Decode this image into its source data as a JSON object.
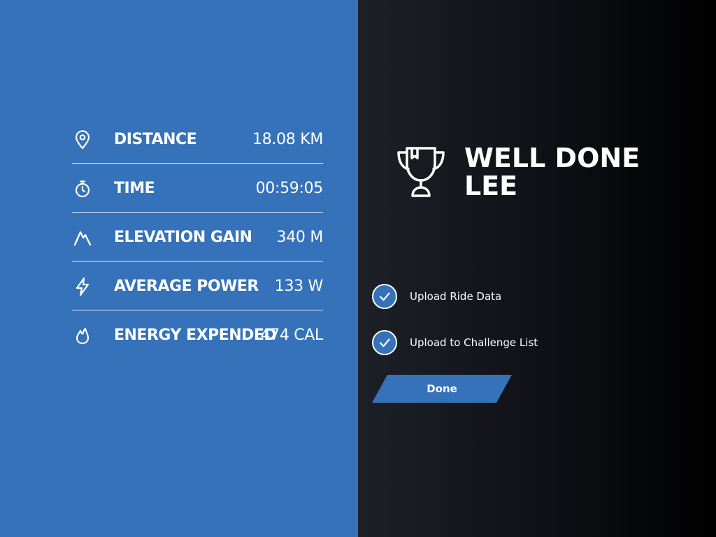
{
  "stats": [
    {
      "icon": "location-pin-icon",
      "label": "DISTANCE",
      "value": "18.08 KM"
    },
    {
      "icon": "stopwatch-icon",
      "label": "TIME",
      "value": "00:59:05"
    },
    {
      "icon": "mountain-icon",
      "label": "ELEVATION GAIN",
      "value": "340 M"
    },
    {
      "icon": "lightning-bolt-icon",
      "label": "AVERAGE POWER",
      "value": "133 W"
    },
    {
      "icon": "flame-icon",
      "label": "ENERGY EXPENDED",
      "value": "474 CAL"
    }
  ],
  "headline": {
    "line1": "WELL DONE",
    "line2": "LEE",
    "icon": "trophy-icon"
  },
  "options": [
    {
      "label": "Upload Ride Data",
      "checked": true
    },
    {
      "label": "Upload to Challenge List",
      "checked": true
    }
  ],
  "done_button": {
    "label": "Done"
  },
  "colors": {
    "accent": "#3572ba",
    "text": "#ffffff",
    "dark_bg": "#0c0d12"
  }
}
